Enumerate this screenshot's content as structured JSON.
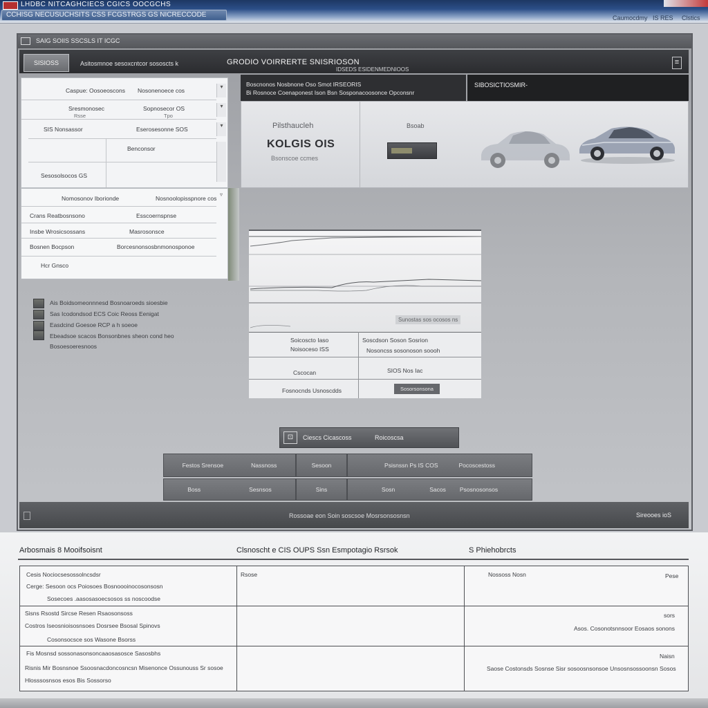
{
  "window": {
    "app_title": "LHDBC NITCAGHCIECS  CGICS  OOCGCHS",
    "address": "CCHISG NECUSUCHSITS CSS FCGSTRGS GS NICRECCODE",
    "status_1": "Caumocdmy",
    "status_2": "IS RES",
    "status_3": "Clstics"
  },
  "frame": {
    "header_text": "SAIG SOIIS   SSCSLS IT ICGC"
  },
  "toolbar": {
    "button_label": "SISIOSS",
    "path_text": "Asitosmnoe sesoxcntcor sososcts k",
    "title": "GRODIO VOIRRERTE SNISRIOSON",
    "subtitle": "IDSEDS ESIDENMEDNIOOS",
    "menu_glyph": "≡"
  },
  "left_panel": {
    "rows": [
      {
        "label": "Caspue: Oosoeoscons",
        "value": "Nosonenoece cos"
      },
      {
        "label": "Sresmonosec",
        "label_small": "Rsse",
        "value": "Sopnosecor OS",
        "value_small": "Tpo"
      },
      {
        "label": "SIS    Nonsassor",
        "value": "Eserosesonne SOS"
      },
      {
        "label": "",
        "value": "Benconsor"
      },
      {
        "label": "Sesosolsocos   GS",
        "value": ""
      }
    ],
    "scroll_glyph": "▾"
  },
  "left_panel2": {
    "rows": [
      {
        "label": "Nomosonov Iborionde",
        "value": "Nosnoolopisspnore cos"
      },
      {
        "label": "Crans   Reatbosnsono",
        "value": "Esscoernspnse"
      },
      {
        "label": "Insbe   Wrosicsossans",
        "value": "Masrosonsce"
      },
      {
        "label": "Bosnen   Bocpson",
        "value": "Borcesnonsosbnmonosponoe"
      },
      {
        "label": "Hcr   Gnsco",
        "value": ""
      }
    ],
    "scroll_glyph": "▿"
  },
  "info": {
    "head_left_line1": "Boscnonos Nosbnone Oso Smot IRSEORIS",
    "head_left_line2": "Bi Rosnoce Coenaponest Ison Bsn Sosponacoosonce Opconsnr",
    "head_right": "SIBOSICTIOSMIR-",
    "vehicle_label": "Pilsthaucleh",
    "vehicle_code": "KOLGIS OIS",
    "vehicle_sub": "Bsonscoe ccmes",
    "conn_label": "Bsoab"
  },
  "graph": {
    "caption": "Sunostas sos ocosos ns"
  },
  "data_table": {
    "r1c1": "Soicoscto Iaso",
    "r1c2": "Soscdson Soson Sosrion",
    "r2c1": "Noisoceso ISS",
    "r2c2": "Nosoncss sosonoson soooh",
    "r3c1": "Cscocan",
    "r3c2": "SIOS Nos Iac",
    "r4c1": "Fosnocnds Usnoscdds",
    "button": "Sosorsonsona"
  },
  "legend": [
    "Ais Boidsomeonnnesd Bosnoaroeds sioesbie",
    "Sas Icodondsod ECS Coic Reoss  Eenigat",
    "Easdcind Goesoe  RCP a h soeoe",
    "Ebeadsoe scacos Bonsonbnes sheon cond heo",
    "Bosoesoeresnoos"
  ],
  "mid_button": {
    "icon_glyph": "⊡",
    "label": "Ciescs Cicascoss",
    "label2": "Roicoscsa"
  },
  "grid": [
    [
      "Festos Srensoe",
      "Nassnoss",
      "Sesoon",
      "Psisnssn Ps IS COS",
      "Pocoscestoss"
    ],
    [
      "Boss",
      "Sesnsos",
      "Sins",
      "Sosn",
      "Sacos",
      "Psosnosonsos"
    ]
  ],
  "statusbar": {
    "center": "Rossoae eon Soin soscsoe Mosrsonsosnsn",
    "right": "Sireooes ioS"
  },
  "report": {
    "head1": "Arbosmais 8 Mooifsoisnt",
    "head2": "Clsnoscht e CIS  OUPS Ssn Esmpotagio Rsrsok",
    "head3": "S Phiehobrcts",
    "row1": {
      "c1_l1": "Cesis  Nociocsesossolncsdsr",
      "c1_l2": "Cerge: Sesoon ocs  Poiosoes Bosnoooinocosonsosn",
      "c1_l3": "Sosecoes .aasosasoecsosos ss noscoodse",
      "c2": "Rsose",
      "c3_a": "Nossoss Nosn",
      "c3_b": "Pese"
    },
    "row2": {
      "c1_l1": "Sisns Rsostd  Sircse Resen  Rsaosonsoss",
      "c1_l2": "Costros  Iseosnioisosnsoes Dosrsee Bsosal Spinovs",
      "c1_l3": "Cosonsocsce sos Wasone Bsorss",
      "c3_a": "sors",
      "c3_b": "Asos.  Cosonotsnnsoor Eosaos sonons"
    },
    "row3": {
      "c1_l1": "Fis    Mosnsd sossonasonsoncaaosasosce  Sasosbhs",
      "c1_l2": "Risnis   Mir Bosnsnoe Ssoosnacdoncosncsn Misenonce Ossunouss Sr sosoe",
      "c1_l3": "Hlosssosnsos esos Bis Sossorso",
      "c3_a": "Naisn",
      "c3_b": "Saose  Costonsds Sosnse Sisr sosoosnsonsoe Unsosnsossoonsn  Sosos"
    }
  },
  "colors": {
    "titlebar": "#2c4f88",
    "toolbar": "#2b2c2f",
    "car_body": "#9ba3b3"
  }
}
